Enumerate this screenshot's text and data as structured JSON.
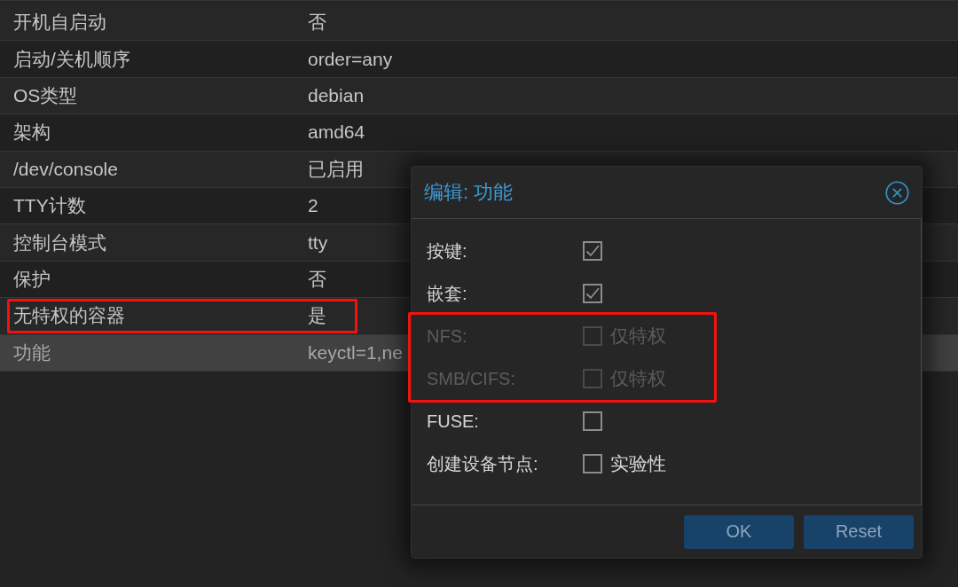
{
  "table": {
    "rows": [
      {
        "key": "开机自启动",
        "value": "否",
        "selected": false,
        "highlighted": false
      },
      {
        "key": "启动/关机顺序",
        "value": "order=any",
        "selected": false,
        "highlighted": false
      },
      {
        "key": "OS类型",
        "value": "debian",
        "selected": false,
        "highlighted": false
      },
      {
        "key": "架构",
        "value": "amd64",
        "selected": false,
        "highlighted": false
      },
      {
        "key": "/dev/console",
        "value": "已启用",
        "selected": false,
        "highlighted": false
      },
      {
        "key": "TTY计数",
        "value": "2",
        "selected": false,
        "highlighted": false
      },
      {
        "key": "控制台模式",
        "value": "tty",
        "selected": false,
        "highlighted": false
      },
      {
        "key": "保护",
        "value": "否",
        "selected": false,
        "highlighted": false
      },
      {
        "key": "无特权的容器",
        "value": "是",
        "selected": false,
        "highlighted": true
      },
      {
        "key": "功能",
        "value": "keyctl=1,ne",
        "selected": true,
        "highlighted": false
      }
    ]
  },
  "dialog": {
    "title": "编辑: 功能",
    "fields": [
      {
        "label": "按键:",
        "checked": true,
        "disabled": false,
        "highlighted": false
      },
      {
        "label": "嵌套:",
        "checked": true,
        "disabled": false,
        "highlighted": false
      },
      {
        "label": "NFS:",
        "checked": false,
        "disabled": true,
        "highlighted": true,
        "box_label": "仅特权"
      },
      {
        "label": "SMB/CIFS:",
        "checked": false,
        "disabled": true,
        "highlighted": true,
        "box_label": "仅特权"
      },
      {
        "label": "FUSE:",
        "checked": false,
        "disabled": false,
        "highlighted": false
      },
      {
        "label": "创建设备节点:",
        "checked": false,
        "disabled": false,
        "highlighted": false,
        "box_label": "实验性"
      }
    ],
    "buttons": [
      {
        "label": "OK"
      },
      {
        "label": "Reset"
      }
    ]
  }
}
